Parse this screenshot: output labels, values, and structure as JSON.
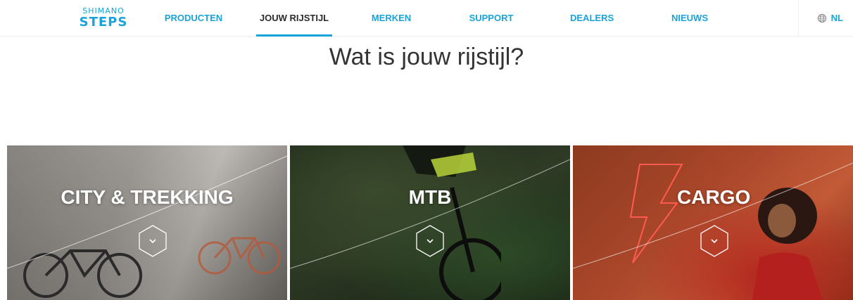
{
  "header": {
    "logo": {
      "top": "SHIMANO",
      "bottom": "STEPS"
    },
    "nav": [
      {
        "label": "PRODUCTEN",
        "active": false
      },
      {
        "label": "JOUW RIJSTIJL",
        "active": true
      },
      {
        "label": "MERKEN",
        "active": false
      },
      {
        "label": "SUPPORT",
        "active": false
      },
      {
        "label": "DEALERS",
        "active": false
      },
      {
        "label": "NIEUWS",
        "active": false
      }
    ],
    "language": {
      "label": "NL",
      "icon": "globe-icon"
    }
  },
  "main": {
    "title": "Wat is jouw rijstijl?",
    "cards": [
      {
        "label": "CITY & TREKKING",
        "icon": "chevron-down-icon"
      },
      {
        "label": "MTB",
        "icon": "chevron-down-icon"
      },
      {
        "label": "CARGO",
        "icon": "chevron-down-icon"
      }
    ]
  },
  "colors": {
    "accent": "#1aa3d8",
    "text_dark": "#333333",
    "cargo_neon": "#ff3b30"
  }
}
